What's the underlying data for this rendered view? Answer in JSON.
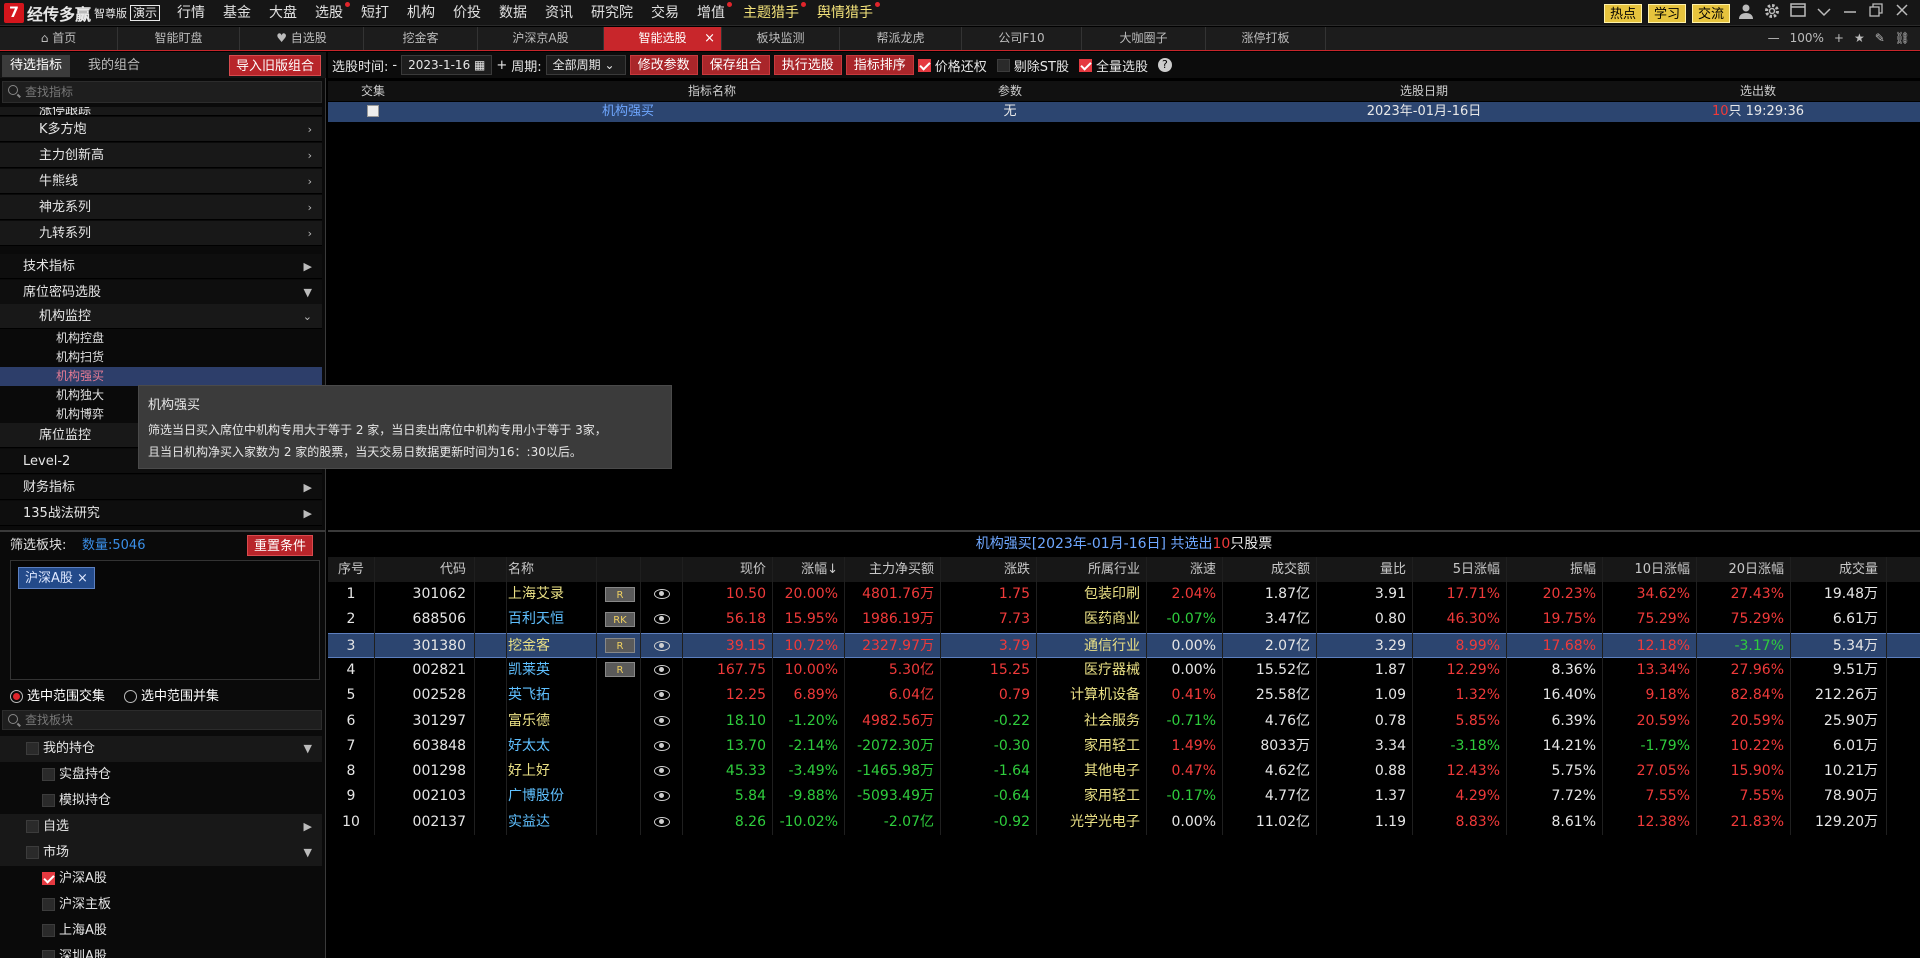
{
  "app": {
    "logo_char": "7",
    "name": "经传多赢",
    "edition": "智尊版",
    "demo": "演示"
  },
  "menu": [
    {
      "label": "行情",
      "dot": false,
      "hl": false
    },
    {
      "label": "基金",
      "dot": false,
      "hl": false
    },
    {
      "label": "大盘",
      "dot": false,
      "hl": false
    },
    {
      "label": "选股",
      "dot": true,
      "hl": false
    },
    {
      "label": "短打",
      "dot": false,
      "hl": false
    },
    {
      "label": "机构",
      "dot": false,
      "hl": false
    },
    {
      "label": "价投",
      "dot": false,
      "hl": false
    },
    {
      "label": "数据",
      "dot": false,
      "hl": false
    },
    {
      "label": "资讯",
      "dot": false,
      "hl": false
    },
    {
      "label": "研究院",
      "dot": false,
      "hl": false
    },
    {
      "label": "交易",
      "dot": false,
      "hl": false
    },
    {
      "label": "增值",
      "dot": true,
      "hl": false
    },
    {
      "label": "主题猎手",
      "dot": true,
      "hl": true
    },
    {
      "label": "舆情猎手",
      "dot": true,
      "hl": true
    }
  ],
  "top_right": {
    "btn1": "热点",
    "btn2": "学习",
    "btn3": "交流"
  },
  "tabs": [
    {
      "label": "首页",
      "icon": "home-icon"
    },
    {
      "label": "智能盯盘"
    },
    {
      "label": "自选股",
      "icon": "heart-icon"
    },
    {
      "label": "挖金客"
    },
    {
      "label": "沪深京A股"
    },
    {
      "label": "智能选股",
      "active": true
    },
    {
      "label": "板块监测"
    },
    {
      "label": "帮派龙虎"
    },
    {
      "label": "公司F10"
    },
    {
      "label": "大咖圈子"
    },
    {
      "label": "涨停打板"
    }
  ],
  "zoom": {
    "minus": "—",
    "level": "100%",
    "plus": "+"
  },
  "left": {
    "tab_active": "待选指标",
    "tab_other": "我的组合",
    "import_btn": "导入旧版组合",
    "search_placeholder": "查找指标",
    "cut_item": "涨停跟踪",
    "items_sub1": [
      "K多方炮",
      "主力创新高",
      "牛熊线",
      "神龙系列",
      "九转系列"
    ],
    "tech": "技术指标",
    "seat": "席位密码选股",
    "inst_monitor": "机构监控",
    "inst_subs": [
      "机构控盘",
      "机构扫货",
      "机构强买",
      "机构独大",
      "机构博弈"
    ],
    "seat_monitor": "席位监控",
    "level2": "Level-2",
    "finance": "财务指标",
    "strategy": "135战法研究",
    "filter_label": "筛选板块:",
    "count_label": "数量:5046",
    "reset_btn": "重置条件",
    "chip": "沪深A股",
    "radio1": "选中范围交集",
    "radio2": "选中范围并集",
    "search2_placeholder": "查找板块",
    "block_tree": [
      {
        "label": "我的持仓",
        "lvl": 1,
        "arrow": "▼",
        "check": false
      },
      {
        "label": "实盘持仓",
        "lvl": 2,
        "check": false
      },
      {
        "label": "模拟持仓",
        "lvl": 2,
        "check": false
      },
      {
        "label": "自选",
        "lvl": 1,
        "arrow": "▶",
        "check": false
      },
      {
        "label": "市场",
        "lvl": 1,
        "arrow": "▼",
        "check": false
      },
      {
        "label": "沪深A股",
        "lvl": 2,
        "check": true
      },
      {
        "label": "沪深主板",
        "lvl": 2,
        "check": false
      },
      {
        "label": "上海A股",
        "lvl": 2,
        "check": false
      },
      {
        "label": "深圳A股",
        "lvl": 2,
        "check": false
      }
    ]
  },
  "tooltip": {
    "title": "机构强买",
    "line1": "筛选当日买入席位中机构专用大于等于 2 家，当日卖出席位中机构专用小于等于 3家，",
    "line2": "且当日机构净买入家数为 2 家的股票，当天交易日数据更新时间为16：:30以后。"
  },
  "toolbar": {
    "date_label": "选股时间:",
    "date_prefix": "-",
    "date_value": "2023-1-16",
    "plus": "+",
    "period_label": "周期:",
    "period_value": "全部周期",
    "btn_params": "修改参数",
    "btn_save": "保存组合",
    "btn_exec": "执行选股",
    "btn_sort": "指标排序",
    "cb1": "价格还权",
    "cb2": "剔除ST股",
    "cb3": "全量选股"
  },
  "upper": {
    "headers": [
      "交集",
      "指标名称",
      "参数",
      "选股日期",
      "选出数"
    ],
    "row": {
      "name": "机构强买",
      "param": "无",
      "date": "2023年-01月-16日",
      "count_num": "10",
      "count_suffix": "只 19:29:36"
    }
  },
  "lower_title": {
    "prefix": "机构强买[2023年-01月-16日] 共选出",
    "num": "10",
    "suffix": "只股票"
  },
  "table": {
    "headers": [
      "序号",
      "代码",
      "名称",
      "",
      "",
      "现价",
      "涨幅↓",
      "主力净买额",
      "涨跌",
      "所属行业",
      "涨速",
      "成交额",
      "量比",
      "5日涨幅",
      "振幅",
      "10日涨幅",
      "20日涨幅",
      "成交量"
    ],
    "rows": [
      {
        "n": "1",
        "code": "301062",
        "name": "上海艾录",
        "tag": "R",
        "price": "10.50",
        "pct": "20.00%",
        "net": "4801.76万",
        "chg": "1.75",
        "ind": "包装印刷",
        "spd": "2.04%",
        "amt": "1.87亿",
        "vr": "3.91",
        "d5": "17.71%",
        "amp": "20.23%",
        "d10": "34.62%",
        "d20": "27.43%",
        "vol": "19.48万",
        "c": [
          "cr",
          "cr",
          "cr",
          "cr",
          "cr",
          "cr",
          "cr",
          "cr",
          "cr"
        ],
        "nc": "cy"
      },
      {
        "n": "2",
        "code": "688506",
        "name": "百利天恒",
        "tag": "RK",
        "price": "56.18",
        "pct": "15.95%",
        "net": "1986.19万",
        "chg": "7.73",
        "ind": "医药商业",
        "spd": "-0.07%",
        "amt": "3.47亿",
        "vr": "0.80",
        "d5": "46.30%",
        "amp": "19.75%",
        "d10": "75.29%",
        "d20": "75.29%",
        "vol": "6.61万",
        "c": [
          "cr",
          "cr",
          "cr",
          "cr",
          "cg",
          "cr",
          "cr",
          "cr",
          "cr"
        ],
        "nc": "cc"
      },
      {
        "n": "3",
        "code": "301380",
        "name": "挖金客",
        "tag": "R",
        "price": "39.15",
        "pct": "10.72%",
        "net": "2327.97万",
        "chg": "3.79",
        "ind": "通信行业",
        "spd": "0.00%",
        "amt": "2.07亿",
        "vr": "3.29",
        "d5": "8.99%",
        "amp": "17.68%",
        "d10": "12.18%",
        "d20": "-3.17%",
        "vol": "5.34万",
        "c": [
          "cr",
          "cr",
          "cr",
          "cr",
          "cw",
          "cr",
          "cr",
          "cr",
          "cg"
        ],
        "nc": "cy",
        "sel": true
      },
      {
        "n": "4",
        "code": "002821",
        "name": "凯莱英",
        "tag": "R",
        "price": "167.75",
        "pct": "10.00%",
        "net": "5.30亿",
        "chg": "15.25",
        "ind": "医疗器械",
        "spd": "0.00%",
        "amt": "15.52亿",
        "vr": "1.87",
        "d5": "12.29%",
        "amp": "8.36%",
        "d10": "13.34%",
        "d20": "27.96%",
        "vol": "9.51万",
        "c": [
          "cr",
          "cr",
          "cr",
          "cr",
          "cw",
          "cr",
          "cw",
          "cr",
          "cr"
        ],
        "nc": "cc"
      },
      {
        "n": "5",
        "code": "002528",
        "name": "英飞拓",
        "tag": "",
        "price": "12.25",
        "pct": "6.89%",
        "net": "6.04亿",
        "chg": "0.79",
        "ind": "计算机设备",
        "spd": "0.41%",
        "amt": "25.58亿",
        "vr": "1.09",
        "d5": "1.32%",
        "amp": "16.40%",
        "d10": "9.18%",
        "d20": "82.84%",
        "vol": "212.26万",
        "c": [
          "cr",
          "cr",
          "cr",
          "cr",
          "cr",
          "cr",
          "cw",
          "cr",
          "cr"
        ],
        "nc": "cc"
      },
      {
        "n": "6",
        "code": "301297",
        "name": "富乐德",
        "tag": "",
        "price": "18.10",
        "pct": "-1.20%",
        "net": "4982.56万",
        "chg": "-0.22",
        "ind": "社会服务",
        "spd": "-0.71%",
        "amt": "4.76亿",
        "vr": "0.78",
        "d5": "5.85%",
        "amp": "6.39%",
        "d10": "20.59%",
        "d20": "20.59%",
        "vol": "25.90万",
        "c": [
          "cg",
          "cg",
          "cr",
          "cg",
          "cg",
          "cr",
          "cw",
          "cr",
          "cr"
        ],
        "nc": "cy"
      },
      {
        "n": "7",
        "code": "603848",
        "name": "好太太",
        "tag": "",
        "price": "13.70",
        "pct": "-2.14%",
        "net": "-2072.30万",
        "chg": "-0.30",
        "ind": "家用轻工",
        "spd": "1.49%",
        "amt": "8033万",
        "vr": "3.34",
        "d5": "-3.18%",
        "amp": "14.21%",
        "d10": "-1.79%",
        "d20": "10.22%",
        "vol": "6.01万",
        "c": [
          "cg",
          "cg",
          "cg",
          "cg",
          "cr",
          "cg",
          "cw",
          "cg",
          "cr"
        ],
        "nc": "cc"
      },
      {
        "n": "8",
        "code": "001298",
        "name": "好上好",
        "tag": "",
        "price": "45.33",
        "pct": "-3.49%",
        "net": "-1465.98万",
        "chg": "-1.64",
        "ind": "其他电子",
        "spd": "0.47%",
        "amt": "4.62亿",
        "vr": "0.88",
        "d5": "12.43%",
        "amp": "5.75%",
        "d10": "27.05%",
        "d20": "15.90%",
        "vol": "10.21万",
        "c": [
          "cg",
          "cg",
          "cg",
          "cg",
          "cr",
          "cr",
          "cw",
          "cr",
          "cr"
        ],
        "nc": "cy"
      },
      {
        "n": "9",
        "code": "002103",
        "name": "广博股份",
        "tag": "",
        "price": "5.84",
        "pct": "-9.88%",
        "net": "-5093.49万",
        "chg": "-0.64",
        "ind": "家用轻工",
        "spd": "-0.17%",
        "amt": "4.77亿",
        "vr": "1.37",
        "d5": "4.29%",
        "amp": "7.72%",
        "d10": "7.55%",
        "d20": "7.55%",
        "vol": "78.90万",
        "c": [
          "cg",
          "cg",
          "cg",
          "cg",
          "cg",
          "cr",
          "cw",
          "cr",
          "cr"
        ],
        "nc": "cc"
      },
      {
        "n": "10",
        "code": "002137",
        "name": "实益达",
        "tag": "",
        "price": "8.26",
        "pct": "-10.02%",
        "net": "-2.07亿",
        "chg": "-0.92",
        "ind": "光学光电子",
        "spd": "0.00%",
        "amt": "11.02亿",
        "vr": "1.19",
        "d5": "8.83%",
        "amp": "8.61%",
        "d10": "12.38%",
        "d20": "21.83%",
        "vol": "129.20万",
        "c": [
          "cg",
          "cg",
          "cg",
          "cg",
          "cw",
          "cr",
          "cw",
          "cr",
          "cr"
        ],
        "nc": "cc"
      }
    ]
  }
}
